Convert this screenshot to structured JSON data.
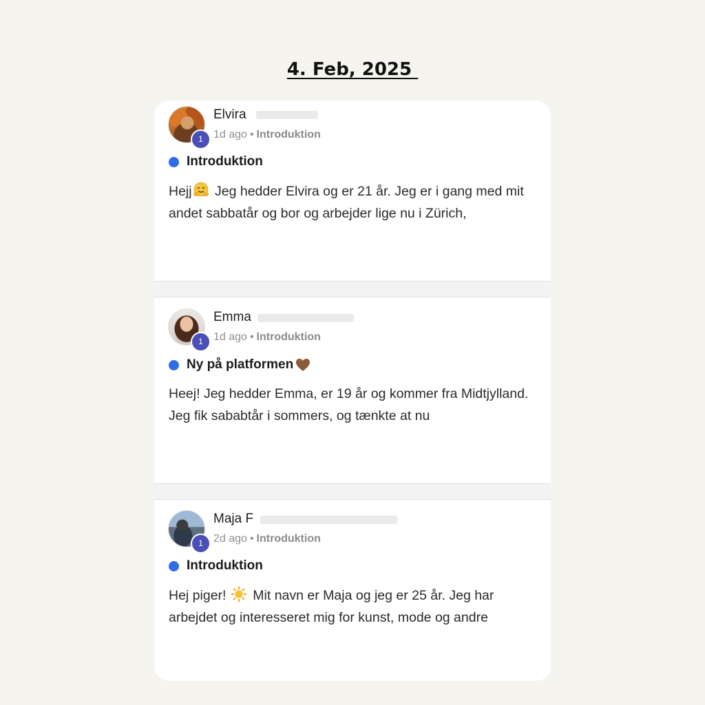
{
  "header": {
    "date": "4. Feb, 2025 "
  },
  "posts": [
    {
      "author": "Elvira",
      "level": "1",
      "time": "1d ago",
      "separator": "•",
      "category": "Introduktion",
      "title": "Introduktion",
      "title_emoji": "",
      "body_before_emoji": "Hejj",
      "body_emoji": "smiling-hug-emoji",
      "body_after_emoji": " Jeg hedder Elvira og er 21 år. Jeg er i gang med mit andet sabbatår og bor og arbejder lige nu i Zürich,"
    },
    {
      "author": "Emma",
      "level": "1",
      "time": "1d ago",
      "separator": "•",
      "category": "Introduktion",
      "title": "Ny på platformen",
      "title_emoji": "brown-heart-emoji",
      "body": "Heej! Jeg hedder Emma, er 19 år og kommer fra Midtjylland. Jeg fik sababtår i sommers, og tænkte at nu"
    },
    {
      "author": "Maja F",
      "level": "1",
      "time": "2d ago",
      "separator": "•",
      "category": "Introduktion",
      "title": "Introduktion",
      "body_before_emoji": "Hej piger! ",
      "body_emoji": "sun-emoji",
      "body_after_emoji": " Mit navn er Maja og jeg er 25 år. Jeg har arbejdet og interesseret mig for kunst, mode og andre"
    }
  ],
  "colors": {
    "background": "#f6f4ef",
    "card": "#ffffff",
    "badge": "#4b4fb8",
    "category_dot": "#2f6de6",
    "meta_text": "#8f8f8f"
  }
}
